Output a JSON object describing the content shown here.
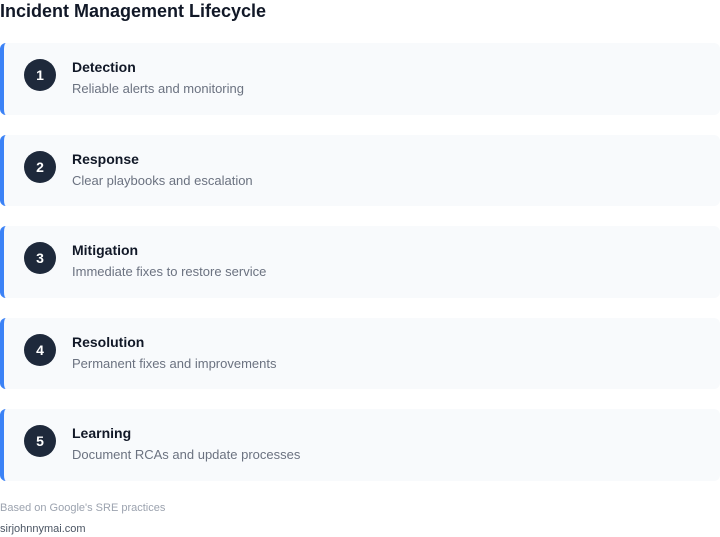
{
  "title": "Incident Management Lifecycle",
  "steps": [
    {
      "number": "1",
      "title": "Detection",
      "description": "Reliable alerts and monitoring"
    },
    {
      "number": "2",
      "title": "Response",
      "description": "Clear playbooks and escalation"
    },
    {
      "number": "3",
      "title": "Mitigation",
      "description": "Immediate fixes to restore service"
    },
    {
      "number": "4",
      "title": "Resolution",
      "description": "Permanent fixes and improvements"
    },
    {
      "number": "5",
      "title": "Learning",
      "description": "Document RCAs and update processes"
    }
  ],
  "footnote": "Based on Google's SRE practices",
  "credit": "sirjohnnymai.com",
  "colors": {
    "accent": "#3b82f6",
    "badge": "#1e293b",
    "card_bg": "#f8fafc"
  }
}
